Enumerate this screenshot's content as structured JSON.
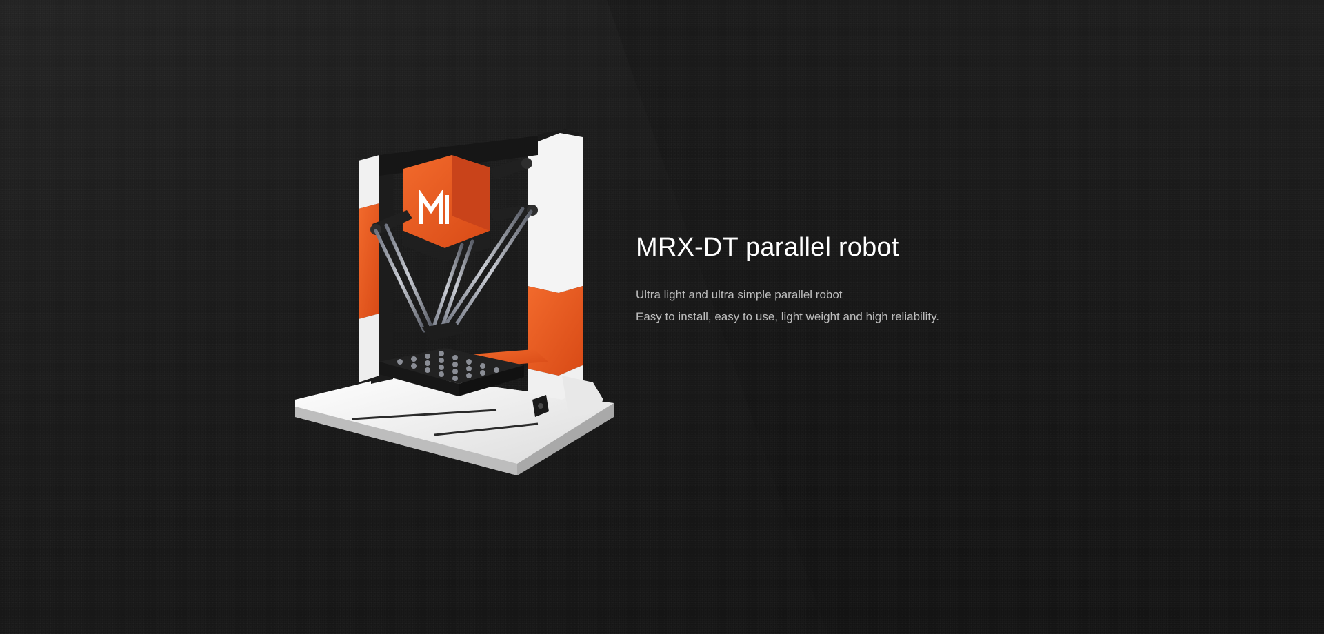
{
  "hero": {
    "title": "MRX-DT parallel robot",
    "description": [
      "Ultra light and ultra simple parallel robot",
      "Easy to install, easy to use, light weight and high reliability."
    ],
    "brand_mark": "M"
  },
  "colors": {
    "accent": "#e8551e",
    "frame_white": "#f2f2f2",
    "background_dark": "#141414",
    "title_text": "#ffffff",
    "body_text": "#bdbdbd"
  },
  "icons": {
    "robot_logo": "m-logo-icon",
    "power_switch": "power-switch-icon"
  }
}
